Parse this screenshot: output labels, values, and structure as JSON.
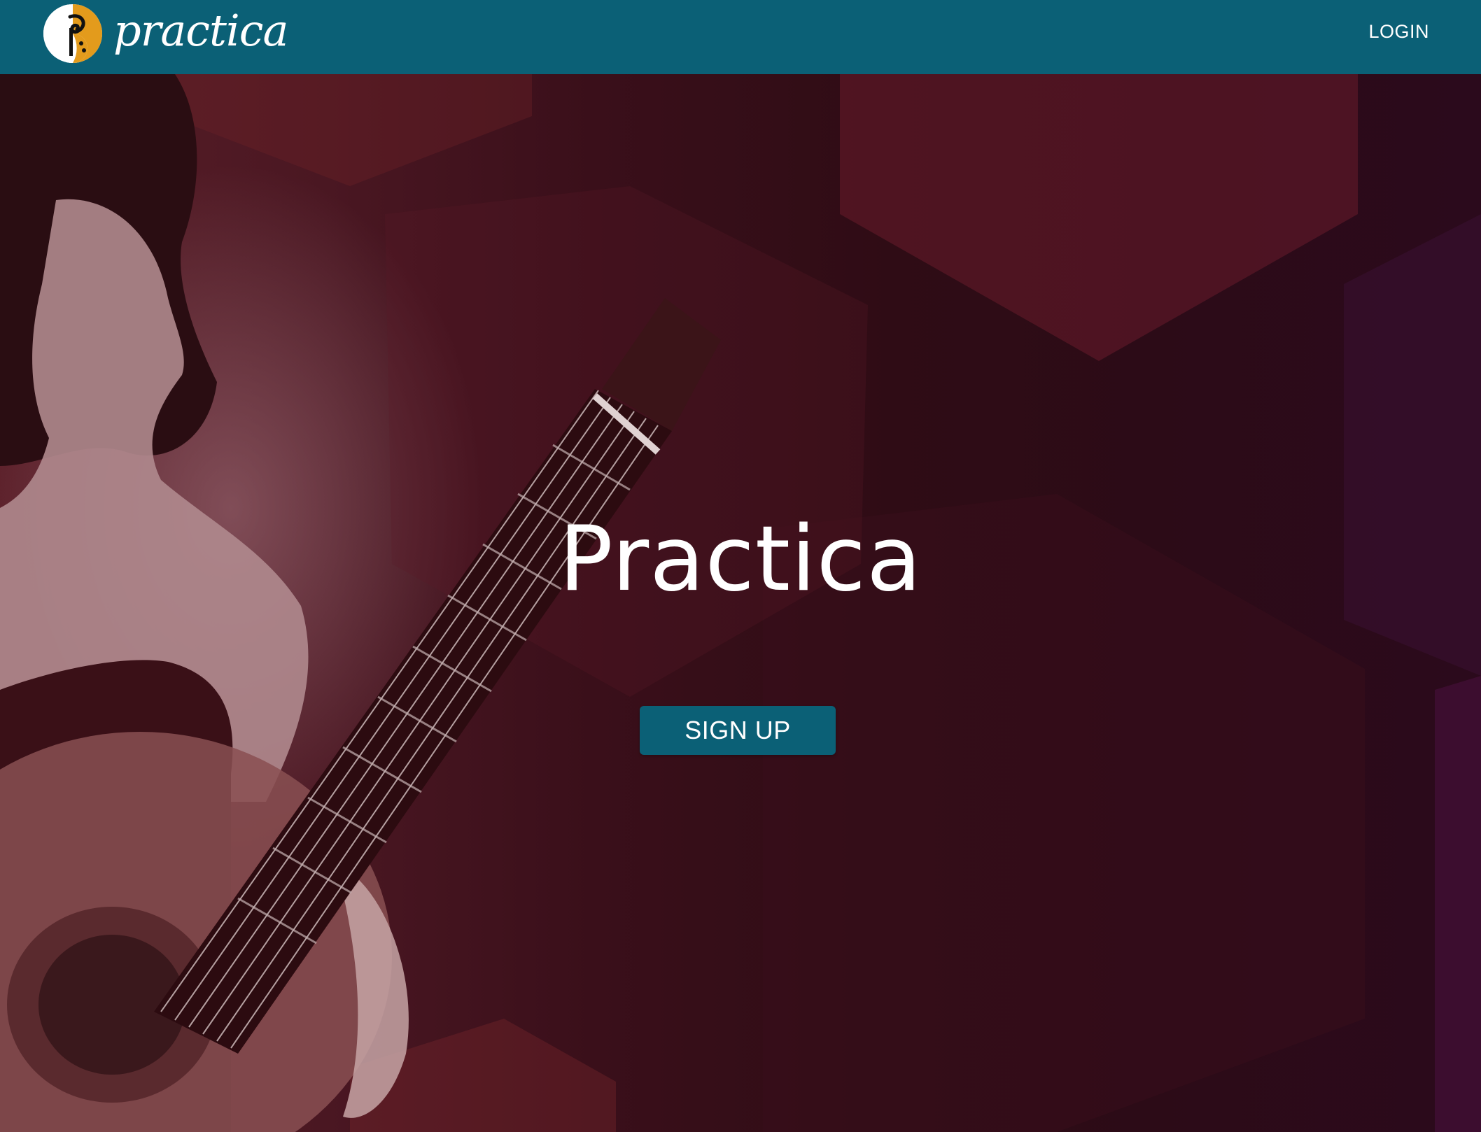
{
  "header": {
    "brand_name": "practica",
    "login_label": "LOGIN",
    "background_color": "#0b6076"
  },
  "hero": {
    "title": "Practica",
    "signup_label": "SIGN UP",
    "background_image": "woman-playing-classical-guitar-photo"
  },
  "icons": {
    "logo": "practica-logo-icon"
  },
  "colors": {
    "brand": "#0b6076",
    "logo_accent": "#e39b1c",
    "text": "#ffffff"
  }
}
